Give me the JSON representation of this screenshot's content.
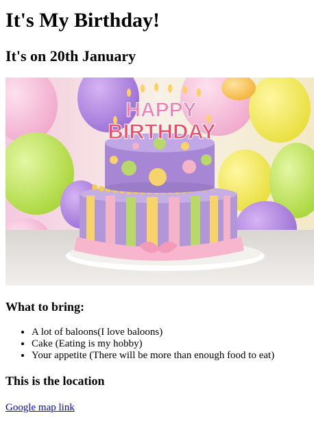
{
  "heading": "It's My Birthday!",
  "subheading": "It's on 20th January",
  "image": {
    "alt": "Birthday cake with HAPPY BIRTHDAY candles",
    "candle_text_line1": "HAPPY",
    "candle_text_line2": "BIRTHDAY"
  },
  "bring": {
    "title": "What to bring:",
    "items": [
      "A lot of baloons(I love baloons)",
      "Cake (Eating is my hobby)",
      "Your appetite (There will be more than enough food to eat)"
    ]
  },
  "location": {
    "title": "This is the location",
    "link_text": "Google map link"
  },
  "colors": {
    "link": "#0000ee",
    "cake_purple": "#9a7cc9",
    "cake_pink": "#f5b3c8"
  }
}
